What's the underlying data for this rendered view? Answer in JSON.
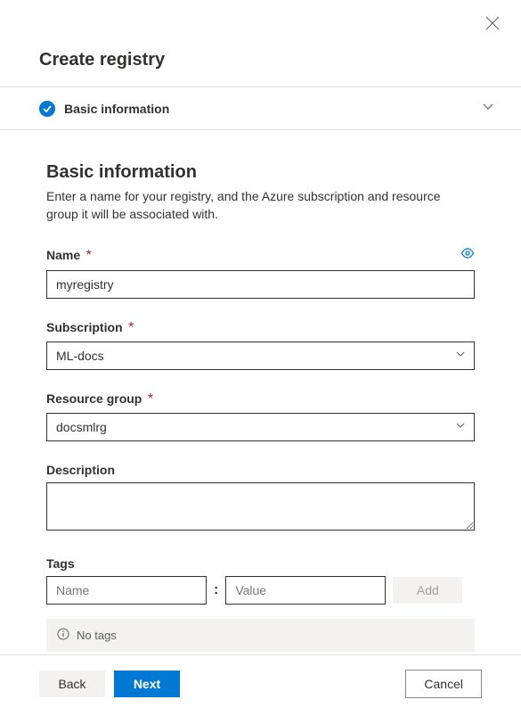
{
  "header": {
    "title": "Create registry"
  },
  "section": {
    "title": "Basic information"
  },
  "form": {
    "heading": "Basic information",
    "description": "Enter a name for your registry, and the Azure subscription and resource group it will be associated with.",
    "name": {
      "label": "Name",
      "value": "myregistry"
    },
    "subscription": {
      "label": "Subscription",
      "value": "ML-docs"
    },
    "resource_group": {
      "label": "Resource group",
      "value": "docsmlrg"
    },
    "description_field": {
      "label": "Description",
      "value": ""
    },
    "tags": {
      "label": "Tags",
      "name_placeholder": "Name",
      "value_placeholder": "Value",
      "separator": ":",
      "add_label": "Add",
      "empty_message": "No tags"
    }
  },
  "footer": {
    "back": "Back",
    "next": "Next",
    "cancel": "Cancel"
  }
}
